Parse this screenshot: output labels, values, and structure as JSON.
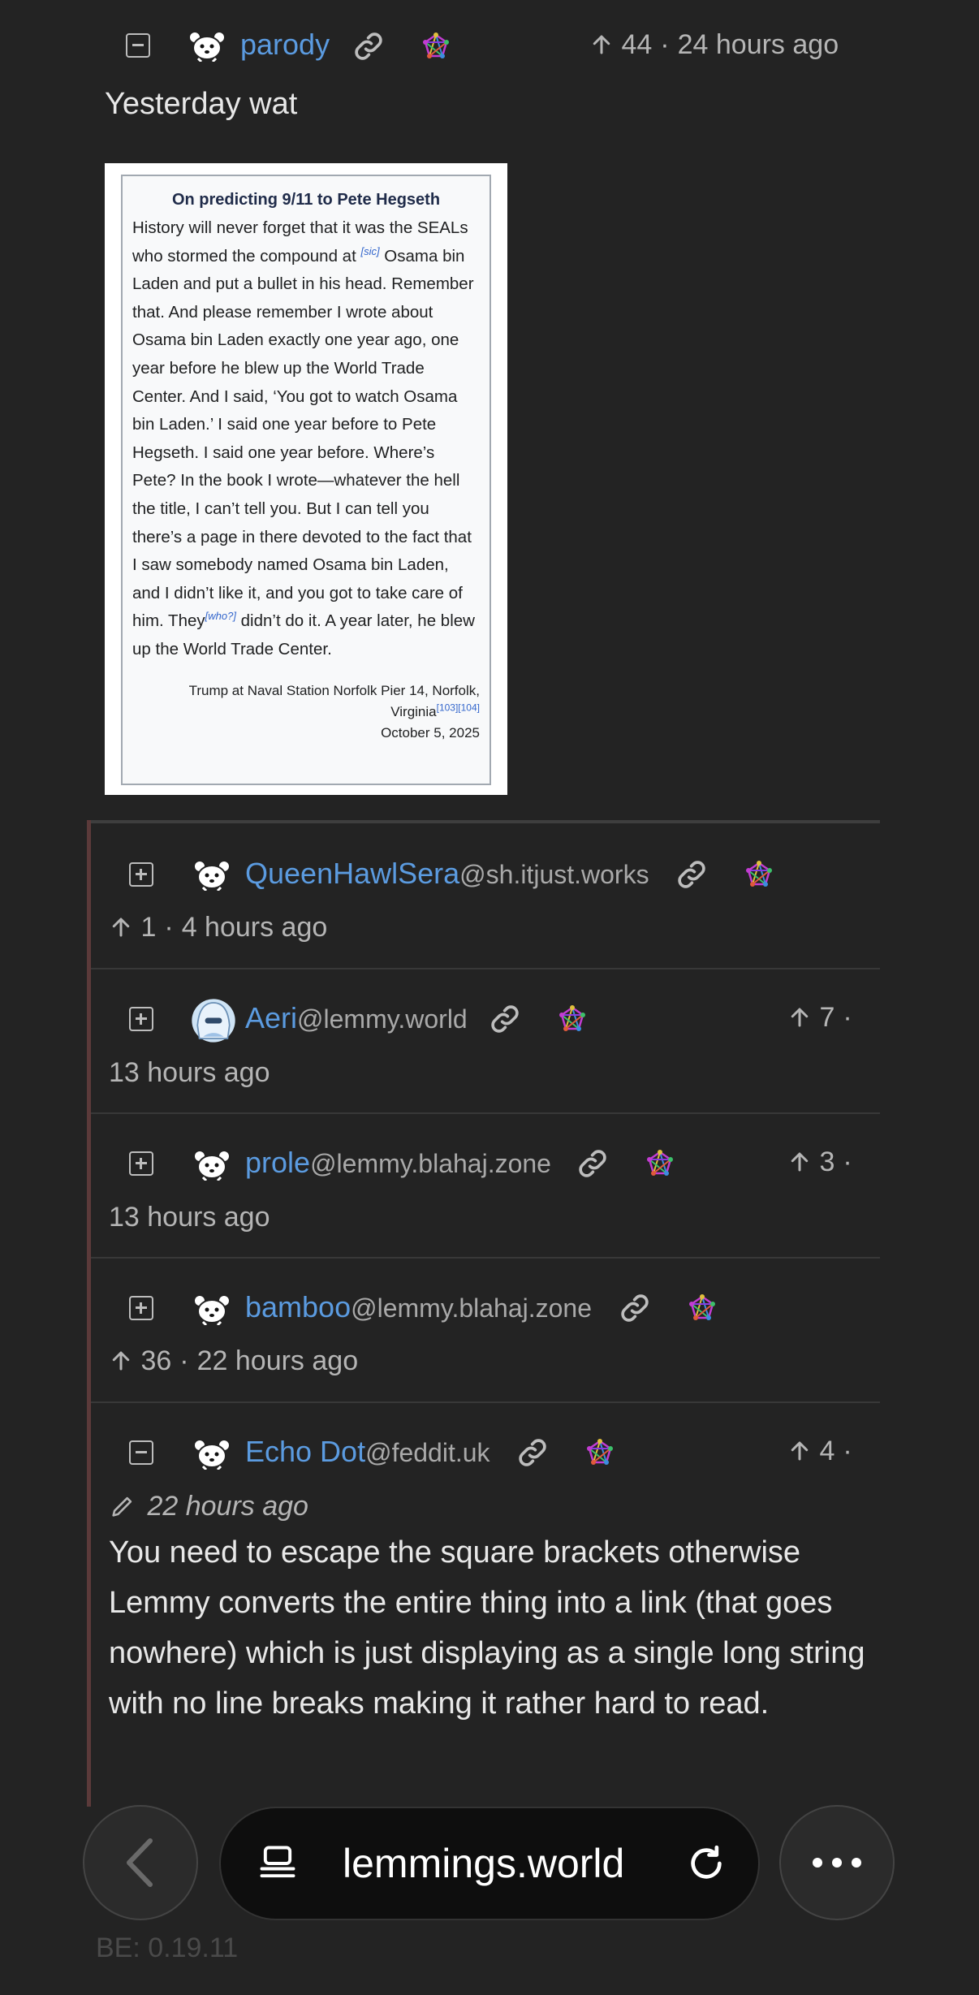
{
  "post": {
    "username": "parody",
    "score": "44",
    "time": "24 hours ago",
    "body": "Yesterday wat"
  },
  "quote_card": {
    "title": "On predicting 9/11 to Pete Hegseth",
    "lines_a": "History will never forget that it was the SEALs who stormed the compound at",
    "sic": "[sic]",
    "lines_b": " Osama bin Laden and put a bullet in his head. Remember that. And please remember I wrote about Osama bin Laden exactly one year ago, one year before he blew up the World Trade Center. And I said, ‘You got to watch Osama bin Laden.’ I said one year before to Pete Hegseth. I said one year before. Where’s Pete? In the book I wrote—whatever the hell the title, I can’t tell you. But I can tell you there’s a page in there devoted to the fact that I saw somebody named Osama bin Laden, and I didn’t like it, and you got to take care of him. They",
    "who": "[who?]",
    "lines_c": " didn’t do it. A year later, he blew up the World Trade Center.",
    "attribution": "Trump at Naval Station Norfolk Pier 14, Norfolk, Virginia",
    "refs": "[103][104]",
    "date": "October 5, 2025"
  },
  "comments": [
    {
      "username": "QueenHawlSera",
      "instance": "@sh.itjust.works",
      "score": "1",
      "time": "4 hours ago"
    },
    {
      "username": "Aeri",
      "instance": "@lemmy.world",
      "score": "7",
      "time": "13 hours ago"
    },
    {
      "username": "prole",
      "instance": "@lemmy.blahaj.zone",
      "score": "3",
      "time": "13 hours ago"
    },
    {
      "username": "bamboo",
      "instance": "@lemmy.blahaj.zone",
      "score": "36",
      "time": "22 hours ago"
    },
    {
      "username": "Echo Dot",
      "instance": "@feddit.uk",
      "score": "4",
      "time": "22 hours ago",
      "body": "You need to escape the square brackets otherwise Lemmy converts the entire thing into a link (that goes nowhere) which is just displaying as a single long string with no line breaks making it rather hard to read."
    }
  ],
  "browser": {
    "url": "lemmings.world",
    "footer": "BE: 0.19.11"
  },
  "icons": {
    "collapse": "minus-square-icon",
    "expand": "plus-square-icon",
    "link": "link-icon",
    "fediverse": "fediverse-icon",
    "upvote": "arrow-up-icon",
    "edited": "pencil-icon"
  }
}
